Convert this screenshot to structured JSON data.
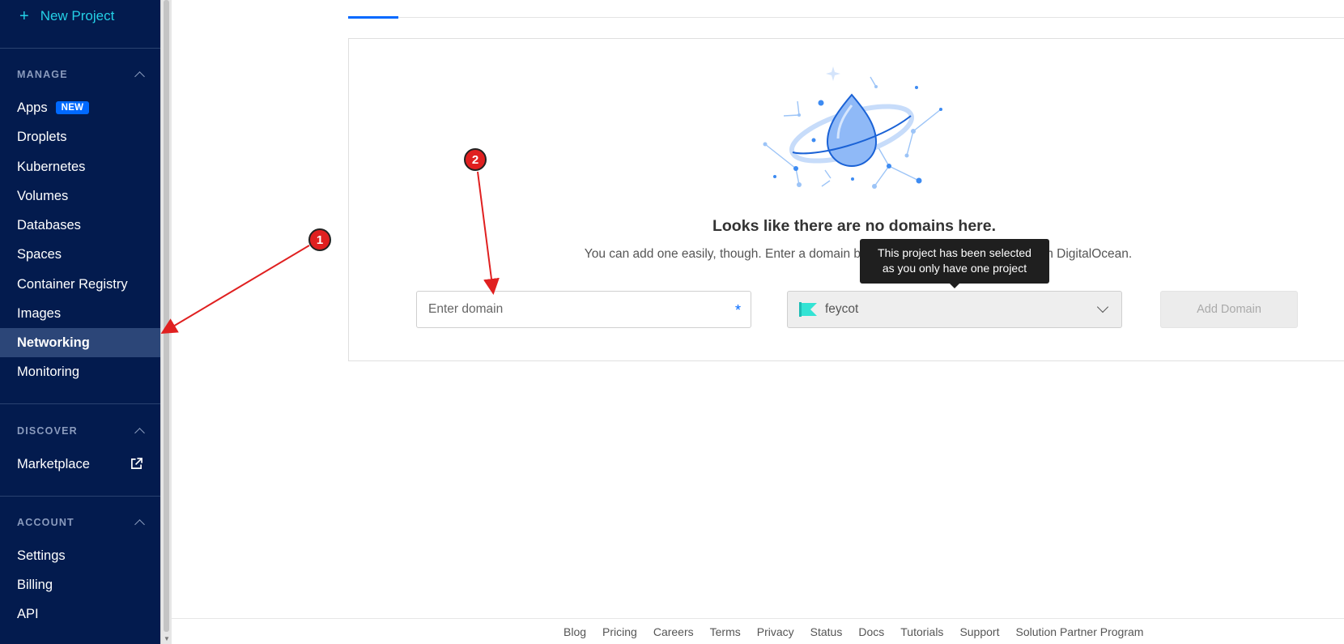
{
  "sidebar": {
    "new_project": "New Project",
    "sections": {
      "manage": "MANAGE",
      "discover": "DISCOVER",
      "account": "ACCOUNT"
    },
    "manage_items": [
      {
        "label": "Apps",
        "badge": "NEW"
      },
      {
        "label": "Droplets"
      },
      {
        "label": "Kubernetes"
      },
      {
        "label": "Volumes"
      },
      {
        "label": "Databases"
      },
      {
        "label": "Spaces"
      },
      {
        "label": "Container Registry"
      },
      {
        "label": "Images"
      },
      {
        "label": "Networking",
        "active": true
      },
      {
        "label": "Monitoring"
      }
    ],
    "discover_items": [
      {
        "label": "Marketplace",
        "icon": "external-link-icon"
      }
    ],
    "account_items": [
      {
        "label": "Settings"
      },
      {
        "label": "Billing"
      },
      {
        "label": "API"
      }
    ]
  },
  "main": {
    "empty_title": "Looks like there are no domains here.",
    "empty_sub": "You can add one easily, though. Enter a domain below and start managing DNS with DigitalOcean.",
    "domain_input": {
      "placeholder": "Enter domain",
      "value": "",
      "required_mark": "*"
    },
    "project_select": {
      "value": "feycot"
    },
    "add_domain": "Add Domain",
    "tooltip": {
      "line1": "This project has been selected",
      "line2": "as you only have one project"
    }
  },
  "footer": {
    "links": [
      "Blog",
      "Pricing",
      "Careers",
      "Terms",
      "Privacy",
      "Status",
      "Docs",
      "Tutorials",
      "Support",
      "Solution Partner Program"
    ]
  },
  "annotations": {
    "marker1": "1",
    "marker2": "2",
    "arrow_color": "#e02020"
  },
  "colors": {
    "sidebar_bg": "#031b4e",
    "accent": "#0069ff",
    "new_project": "#24d0e6"
  }
}
